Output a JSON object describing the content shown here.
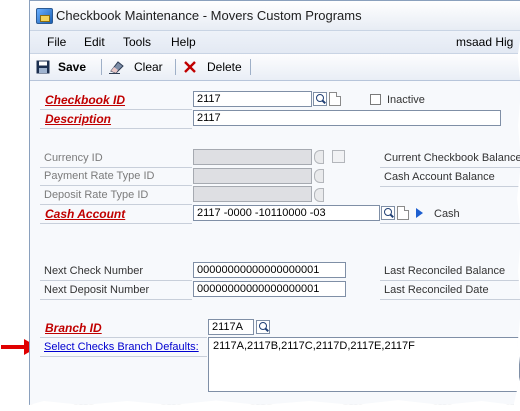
{
  "window": {
    "title": "Checkbook Maintenance  -  Movers Custom Programs"
  },
  "menu": {
    "items": [
      "File",
      "Edit",
      "Tools",
      "Help"
    ],
    "user": "msaad  Hig"
  },
  "toolbar": {
    "save_label": "Save",
    "clear_label": "Clear",
    "delete_label": "Delete"
  },
  "form": {
    "checkbook_id": {
      "label": "Checkbook ID",
      "value": "2117"
    },
    "inactive_label": "Inactive",
    "description": {
      "label": "Description",
      "value": "2117"
    },
    "currency_id_label": "Currency ID",
    "payment_rate_type_label": "Payment Rate Type ID",
    "deposit_rate_type_label": "Deposit Rate Type ID",
    "cash_account": {
      "label": "Cash Account",
      "value": "2117 -0000 -10110000 -03",
      "link_label": "Cash"
    },
    "current_checkbook_balance_label": "Current Checkbook Balance",
    "cash_account_balance_label": "Cash Account Balance",
    "next_check_number": {
      "label": "Next Check Number",
      "value": "00000000000000000001"
    },
    "next_deposit_number": {
      "label": "Next Deposit Number",
      "value": "00000000000000000001"
    },
    "last_reconciled_balance_label": "Last Reconciled Balance",
    "last_reconciled_date_label": "Last Reconciled Date",
    "branch_id": {
      "label": "Branch ID",
      "value": "2117A"
    },
    "select_checks_branch_defaults": {
      "label": "Select Checks Branch Defaults:",
      "value": "2117A,2117B,2117C,2117D,2117E,2117F"
    }
  },
  "colors": {
    "required_label": "#c00000",
    "annotation_arrow": "#e00000",
    "link": "#0000d0"
  }
}
